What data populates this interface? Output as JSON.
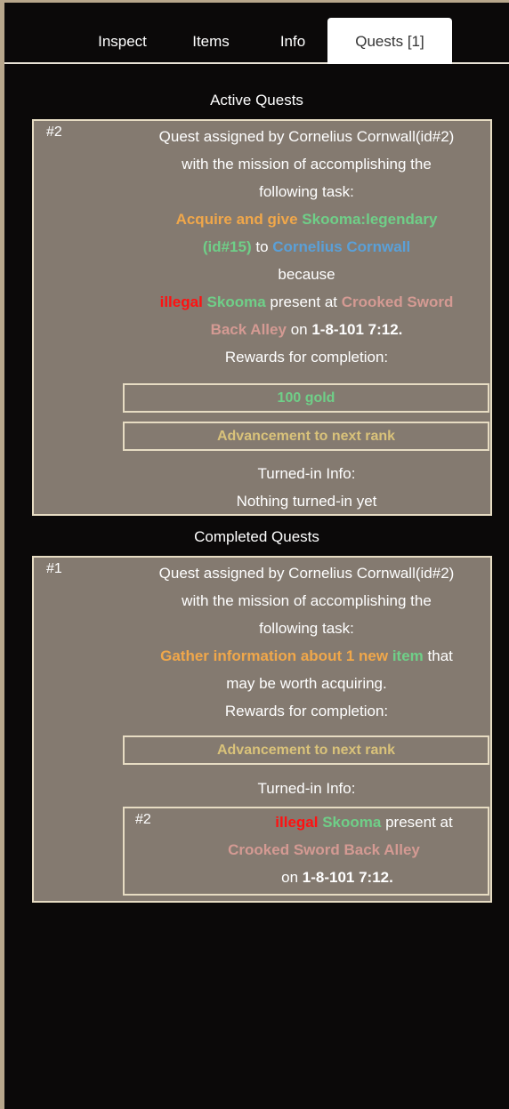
{
  "tabs": [
    {
      "label": "Inspect",
      "active": false
    },
    {
      "label": "Items",
      "active": false
    },
    {
      "label": "Info",
      "active": false
    },
    {
      "label": "Quests [1]",
      "active": true
    }
  ],
  "active_section_title": "Active Quests",
  "completed_section_title": "Completed Quests",
  "active_quests": [
    {
      "id": "#2",
      "assigned_line": "Quest assigned by Cornelius Cornwall(id#2)",
      "mission_line": "with the mission of accomplishing the",
      "task_intro": "following task:",
      "task_verb": "Acquire and give",
      "task_item": "Skooma:legendary",
      "task_item_id": "(id#15)",
      "task_to": "to",
      "task_target": "Cornelius Cornwall",
      "because": "because",
      "reason_status": "illegal",
      "reason_item": "Skooma",
      "reason_present": "present at",
      "reason_location_1": "Crooked Sword",
      "reason_location_2": "Back Alley",
      "reason_on": "on",
      "reason_date": "1-8-101 7:12.",
      "rewards_label": "Rewards for completion:",
      "rewards": [
        "100 gold",
        "Advancement to next rank"
      ],
      "turnin_label": "Turned-in Info:",
      "turnin_value": "Nothing turned-in yet"
    }
  ],
  "completed_quests": [
    {
      "id": "#1",
      "assigned_line": "Quest assigned by Cornelius Cornwall(id#2)",
      "mission_line": "with the mission of accomplishing the",
      "task_intro": "following task:",
      "task_verb": "Gather information about 1 new",
      "task_item": "item",
      "task_that": "that",
      "task_tail": "may be worth acquiring.",
      "rewards_label": "Rewards for completion:",
      "rewards": [
        "Advancement to next rank"
      ],
      "turnin_label": "Turned-in Info:",
      "turnin_entry": {
        "id": "#2",
        "status": "illegal",
        "item": "Skooma",
        "present": "present at",
        "location": "Crooked Sword Back Alley",
        "on": "on",
        "date": "1-8-101 7:12."
      }
    }
  ],
  "colors": {
    "background": "#0b0909",
    "card": "#847a70",
    "card_border": "#e7dcc3",
    "orange": "#f0a74a",
    "green": "#6fcf88",
    "blue": "#5aa0d8",
    "red": "#ff1111",
    "pink": "#d49a93",
    "gold": "#d9c27a"
  }
}
